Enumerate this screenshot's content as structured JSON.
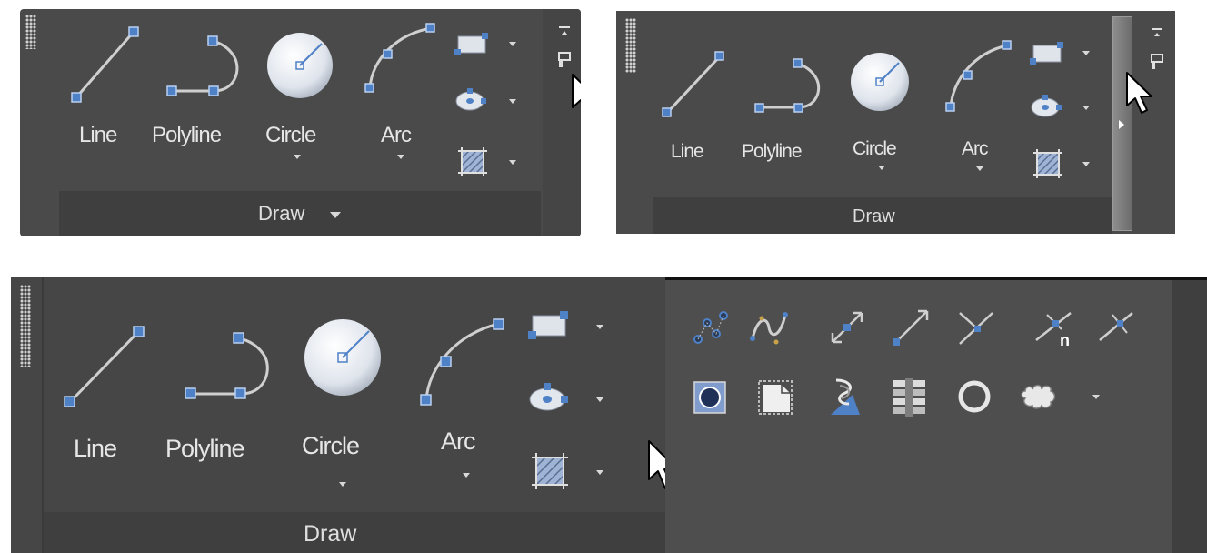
{
  "panel_a": {
    "buttons": {
      "line": "Line",
      "polyline": "Polyline",
      "circle": "Circle",
      "arc": "Arc"
    },
    "panel_title": "Draw"
  },
  "panel_b": {
    "buttons": {
      "line": "Line",
      "polyline": "Polyline",
      "circle": "Circle",
      "arc": "Arc"
    },
    "panel_title": "Draw"
  },
  "panel_c": {
    "buttons": {
      "line": "Line",
      "polyline": "Polyline",
      "circle": "Circle",
      "arc": "Arc"
    },
    "panel_title": "Draw",
    "expanded_row1_icons": [
      "multipoint-icon",
      "spline-icon",
      "xline-icon",
      "ray-icon",
      "construction-line-icon",
      "divide-icon",
      "measure-icon"
    ],
    "expanded_row2_icons": [
      "region-icon",
      "wipeout-icon",
      "3d-polyline-icon",
      "helix-icon",
      "donut-icon",
      "revision-cloud-icon"
    ]
  },
  "colors": {
    "panel_bg": "#4a4a4a",
    "footer_bg": "#3f3f3f",
    "accent": "#4f81c7",
    "text": "#e6e6e6"
  }
}
